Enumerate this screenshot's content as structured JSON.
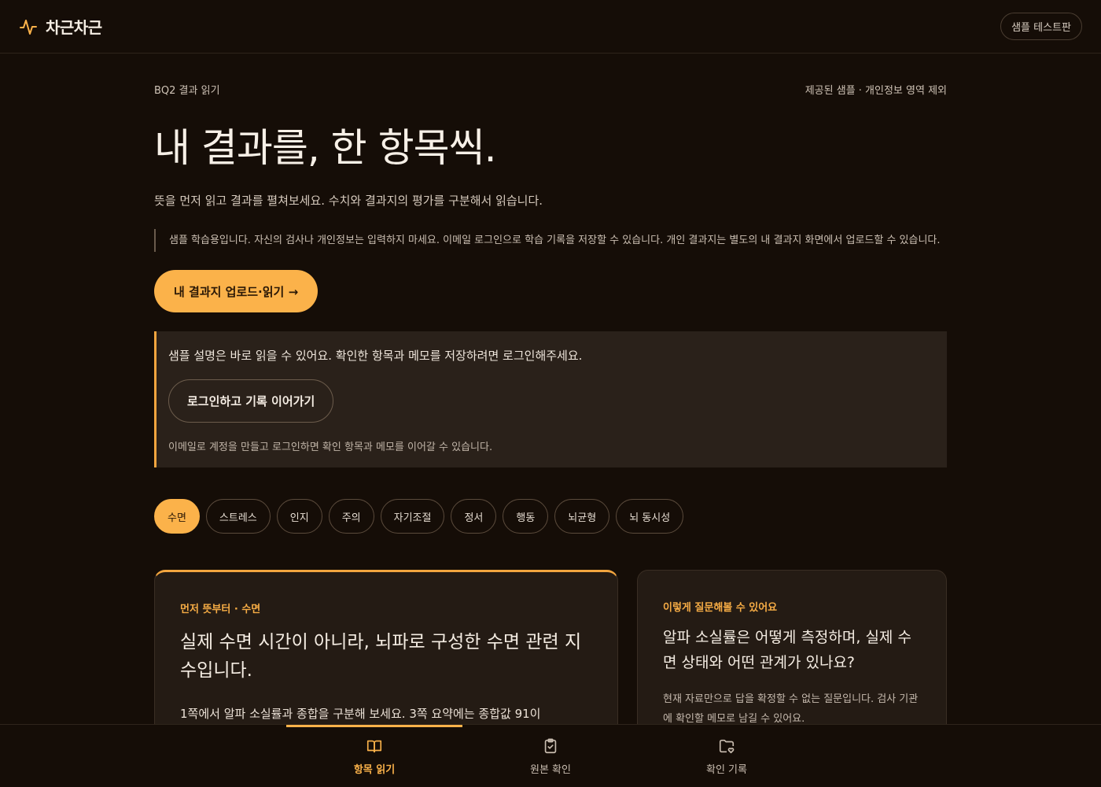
{
  "header": {
    "brand_name": "차근차근",
    "brand_icon": "pulse-icon",
    "sample_badge": "샘플 테스트판"
  },
  "page": {
    "breadcrumb": "BQ2 결과 읽기",
    "meta_note": "제공된 샘플 · 개인정보 영역 제외",
    "title": "내 결과를, 한 항목씩.",
    "subtitle": "뜻을 먼저 읽고 결과를 펼쳐보세요. 수치와 결과지의 평가를 구분해서 읽습니다.",
    "notice": "샘플 학습용입니다. 자신의 검사나 개인정보는 입력하지 마세요. 이메일 로그인으로 학습 기록을 저장할 수 있습니다. 개인 결과지는 별도의 내 결과지 화면에서 업로드할 수 있습니다.",
    "cta_label": "내 결과지 업로드·읽기 →"
  },
  "login_box": {
    "lead": "샘플 설명은 바로 읽을 수 있어요. 확인한 항목과 메모를 저장하려면 로그인해주세요.",
    "button_label": "로그인하고 기록 이어가기",
    "note": "이메일로 계정을 만들고 로그인하면 확인 항목과 메모를 이어갈 수 있습니다."
  },
  "tabs": [
    {
      "label": "수면",
      "active": true
    },
    {
      "label": "스트레스",
      "active": false
    },
    {
      "label": "인지",
      "active": false
    },
    {
      "label": "주의",
      "active": false
    },
    {
      "label": "자기조절",
      "active": false
    },
    {
      "label": "정서",
      "active": false
    },
    {
      "label": "행동",
      "active": false
    },
    {
      "label": "뇌균형",
      "active": false
    },
    {
      "label": "뇌 동시성",
      "active": false
    }
  ],
  "main_card": {
    "eyebrow": "먼저 뜻부터 · 수면",
    "title": "실제 수면 시간이 아니라, 뇌파로 구성한 수면 관련 지수입니다.",
    "body": "1쪽에서 알파 소실률과 종합을 구분해 보세요. 3쪽 요약에는 종합값 91이"
  },
  "side_card": {
    "eyebrow": "이렇게 질문해볼 수 있어요",
    "title": "알파 소실률은 어떻게 측정하며, 실제 수면 상태와 어떤 관계가 있나요?",
    "body": "현재 자료만으로 답을 확정할 수 없는 질문입니다. 검사 기관에 확인할 메모로 남길 수 있어요."
  },
  "bottom_nav": {
    "items": [
      {
        "label": "항목 읽기",
        "icon": "book-icon",
        "active": true
      },
      {
        "label": "원본 확인",
        "icon": "clipboard-check-icon",
        "active": false
      },
      {
        "label": "확인 기록",
        "icon": "folder-heart-icon",
        "active": false
      }
    ]
  },
  "colors": {
    "background": "#150d07",
    "accent": "#fbb24a",
    "card": "#241b14"
  }
}
